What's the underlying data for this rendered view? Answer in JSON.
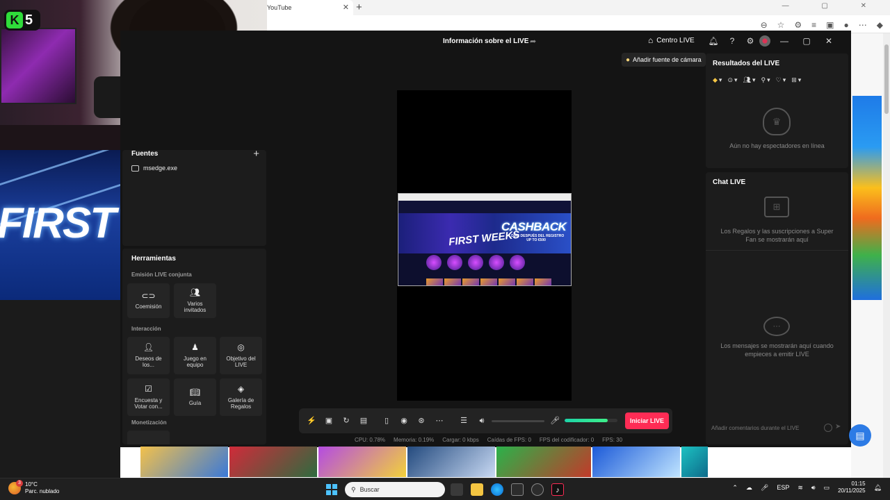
{
  "browser": {
    "tab_title": "YouTube",
    "tab_close": "✕",
    "new_tab": "+",
    "window_controls": "—  ▢  ✕"
  },
  "webcam": {
    "logo_letter": "K",
    "logo_number": "5"
  },
  "preview": {
    "first_text": "FIRST"
  },
  "studio": {
    "title": "Información sobre el LIVE",
    "centro_live_label": "Centro LIVE",
    "camera_source_label": "Añadir fuente de cámara",
    "sources": {
      "title": "Fuentes",
      "add": "+",
      "items": [
        {
          "label": "msedge.exe"
        }
      ]
    },
    "tools": {
      "title": "Herramientas",
      "sections": [
        {
          "label": "Emisión LIVE conjunta"
        },
        {
          "label": "Interacción"
        },
        {
          "label": "Monetización"
        }
      ],
      "tiles": [
        {
          "label": "Coemisión",
          "icon": "link-icon"
        },
        {
          "label": "Varios invitados",
          "icon": "users-icon"
        },
        {
          "label": "Deseos de los...",
          "icon": "wish-icon"
        },
        {
          "label": "Juego en equipo",
          "icon": "team-game-icon"
        },
        {
          "label": "Objetivo del LIVE",
          "icon": "target-icon"
        },
        {
          "label": "Encuesta y Votar con...",
          "icon": "poll-icon"
        },
        {
          "label": "Guía",
          "icon": "guide-icon"
        },
        {
          "label": "Galería de Regalos",
          "icon": "gift-gallery-icon"
        }
      ]
    },
    "go_live_label": "Iniciar LIVE",
    "mic_level": 0.82,
    "stats": {
      "cpu": "CPU:  0.78%",
      "memory": "Memoria:  0.19%",
      "load": "Cargar:  0 kbps",
      "fps_drops": "Caídas de FPS:  0",
      "encoder_fps": "FPS del codificador:  0",
      "fps": "FPS:  30"
    },
    "results": {
      "title": "Resultados del LIVE",
      "empty_text": "Aún no hay espectadores en línea"
    },
    "chat": {
      "title": "Chat LIVE",
      "gift_text": "Los Regalos y las suscripciones a Super Fan se mostrarán aquí",
      "empty_text": "Los mensajes se mostrarán aquí cuando empieces a emitir LIVE",
      "input_placeholder": "Añadir comentarios durante el LIVE"
    }
  },
  "captured_site": {
    "banner_title": "CASHBACK",
    "banner_sub": "7 DÍAS DESPUÉS DEL REGISTRO\nUP TO €500",
    "first_weeks": "FIRST WEEKS"
  },
  "taskbar": {
    "temperature": "10°C",
    "weather": "Parc. nublado",
    "weather_badge": "3",
    "search_label": "Buscar",
    "language": "ESP",
    "time": "01:15",
    "date": "20/11/2025"
  },
  "colors": {
    "accent": "#fe2c55",
    "panel": "#1c1c1c",
    "background": "#141414",
    "mic_level": "#3ef08a"
  }
}
